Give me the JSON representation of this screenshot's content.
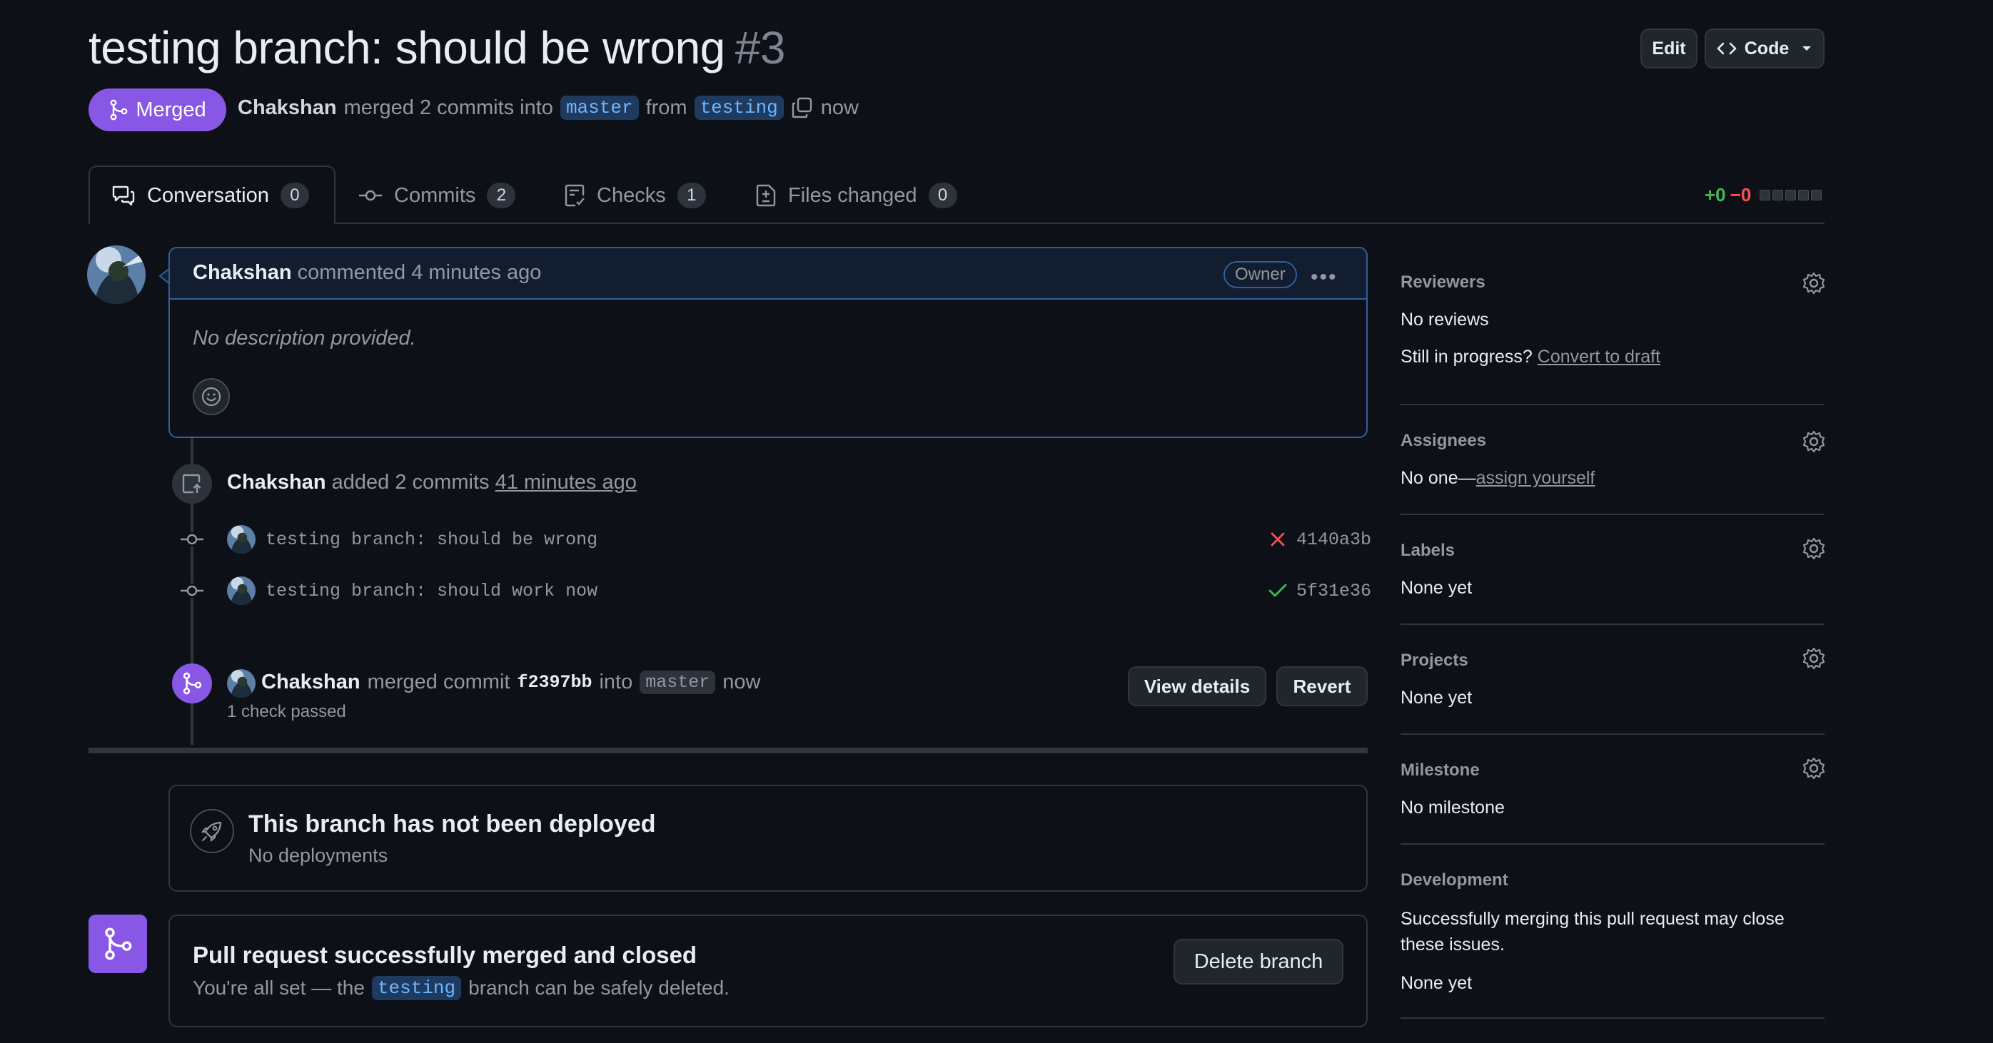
{
  "header": {
    "title": "testing branch: should be wrong",
    "number": "#3",
    "edit_label": "Edit",
    "code_label": "Code"
  },
  "status": {
    "badge": "Merged",
    "author": "Chakshan",
    "merged_text": "merged 2 commits into",
    "base_branch": "master",
    "from_text": "from",
    "head_branch": "testing",
    "time": "now"
  },
  "tabs": [
    {
      "label": "Conversation",
      "count": "0"
    },
    {
      "label": "Commits",
      "count": "2"
    },
    {
      "label": "Checks",
      "count": "1"
    },
    {
      "label": "Files changed",
      "count": "0"
    }
  ],
  "diffstat": {
    "additions": "+0",
    "deletions": "−0"
  },
  "comment": {
    "author": "Chakshan",
    "action": "commented 4 minutes ago",
    "role": "Owner",
    "body": "No description provided."
  },
  "commits_event": {
    "author": "Chakshan",
    "text": "added 2 commits",
    "time": "41 minutes ago",
    "commits": [
      {
        "message": "testing branch: should be wrong",
        "sha": "4140a3b",
        "status": "fail"
      },
      {
        "message": "testing branch: should work now",
        "sha": "5f31e36",
        "status": "pass"
      }
    ]
  },
  "merge_event": {
    "author": "Chakshan",
    "text": "merged commit",
    "sha": "f2397bb",
    "into": "into",
    "branch": "master",
    "time": "now",
    "checks": "1 check passed",
    "view_details": "View details",
    "revert": "Revert"
  },
  "deploy": {
    "title": "This branch has not been deployed",
    "subtitle": "No deployments"
  },
  "merged_box": {
    "title": "Pull request successfully merged and closed",
    "text_before": "You're all set — the",
    "branch": "testing",
    "text_after": "branch can be safely deleted.",
    "delete_label": "Delete branch"
  },
  "sidebar": {
    "reviewers": {
      "title": "Reviewers",
      "value": "No reviews",
      "draft_prefix": "Still in progress?",
      "draft_link": "Convert to draft"
    },
    "assignees": {
      "title": "Assignees",
      "value": "No one—",
      "link": "assign yourself"
    },
    "labels": {
      "title": "Labels",
      "value": "None yet"
    },
    "projects": {
      "title": "Projects",
      "value": "None yet"
    },
    "milestone": {
      "title": "Milestone",
      "value": "No milestone"
    },
    "development": {
      "title": "Development",
      "value": "Successfully merging this pull request may close these issues.",
      "none": "None yet"
    }
  },
  "colors": {
    "background": "#0d1117",
    "merged_purple": "#8957e5",
    "border_blue": "#2f5ea3",
    "success_green": "#3fb950",
    "danger_red": "#f85149"
  }
}
